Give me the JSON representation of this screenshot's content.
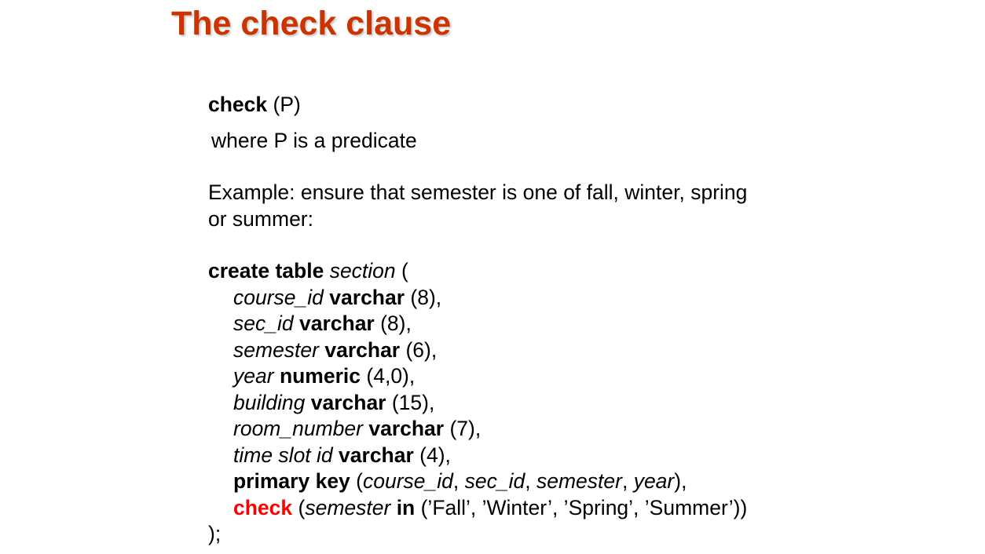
{
  "slide": {
    "title": "The check clause",
    "syntax_keyword": "check",
    "syntax_arg": " (P)",
    "where_text": "where P is a predicate",
    "example_line1": "Example:  ensure that semester is one of fall, winter, spring",
    "example_line2": "or summer:"
  },
  "code": {
    "create_kw": "create table",
    "table_name": "section",
    "open_paren": " (",
    "columns": [
      {
        "name": "course_id",
        "type": "varchar",
        "size": " (8),"
      },
      {
        "name": "sec_id",
        "type": "varchar",
        "size": " (8),"
      },
      {
        "name": "semester",
        "type": "varchar",
        "size": " (6),"
      },
      {
        "name": "year",
        "type": "numeric",
        "size": " (4,0),"
      },
      {
        "name": "building",
        "type": "varchar",
        "size": " (15),"
      },
      {
        "name": "room_number",
        "type": "varchar",
        "size": " (7),"
      },
      {
        "name": "time slot id",
        "type": "varchar",
        "size": " (4),"
      }
    ],
    "pk_kw": "primary key",
    "pk_open": " (",
    "pk_cols": [
      "course_id",
      "sec_id",
      "semester",
      "year"
    ],
    "pk_sep": ", ",
    "pk_close": "),",
    "check_kw": "check",
    "check_open": " (",
    "check_col": "semester",
    "in_kw": "in",
    "check_values": " (’Fall’, ’Winter’, ’Spring’, ’Summer’))",
    "close": ");"
  }
}
